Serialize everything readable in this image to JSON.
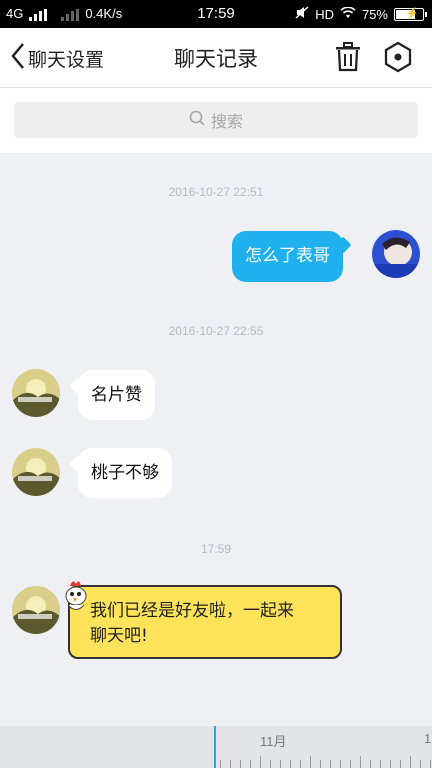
{
  "status_bar": {
    "network": "4G",
    "speed": "0.4K/s",
    "time": "17:59",
    "hd": "HD",
    "battery": "75%",
    "battery_level": 0.75
  },
  "header": {
    "back_label": "聊天设置",
    "title": "聊天记录"
  },
  "search": {
    "placeholder": "搜索"
  },
  "messages": [
    {
      "type": "timestamp",
      "text": "2016-10-27 22:51"
    },
    {
      "type": "sent",
      "text": "怎么了表哥"
    },
    {
      "type": "timestamp",
      "text": "2016-10-27 22:55"
    },
    {
      "type": "received",
      "text": "名片赞"
    },
    {
      "type": "received",
      "text": "桃子不够"
    },
    {
      "type": "timestamp",
      "text": "17:59"
    },
    {
      "type": "received_special",
      "line1": "我们已经是好友啦，一起来",
      "line2": "聊天吧!"
    }
  ],
  "timeline": {
    "month_label": "11月",
    "next_label": "1"
  },
  "colors": {
    "accent": "#1fb0ee",
    "sticker_bubble": "#fde35a",
    "chat_bg": "#eef0f4"
  }
}
